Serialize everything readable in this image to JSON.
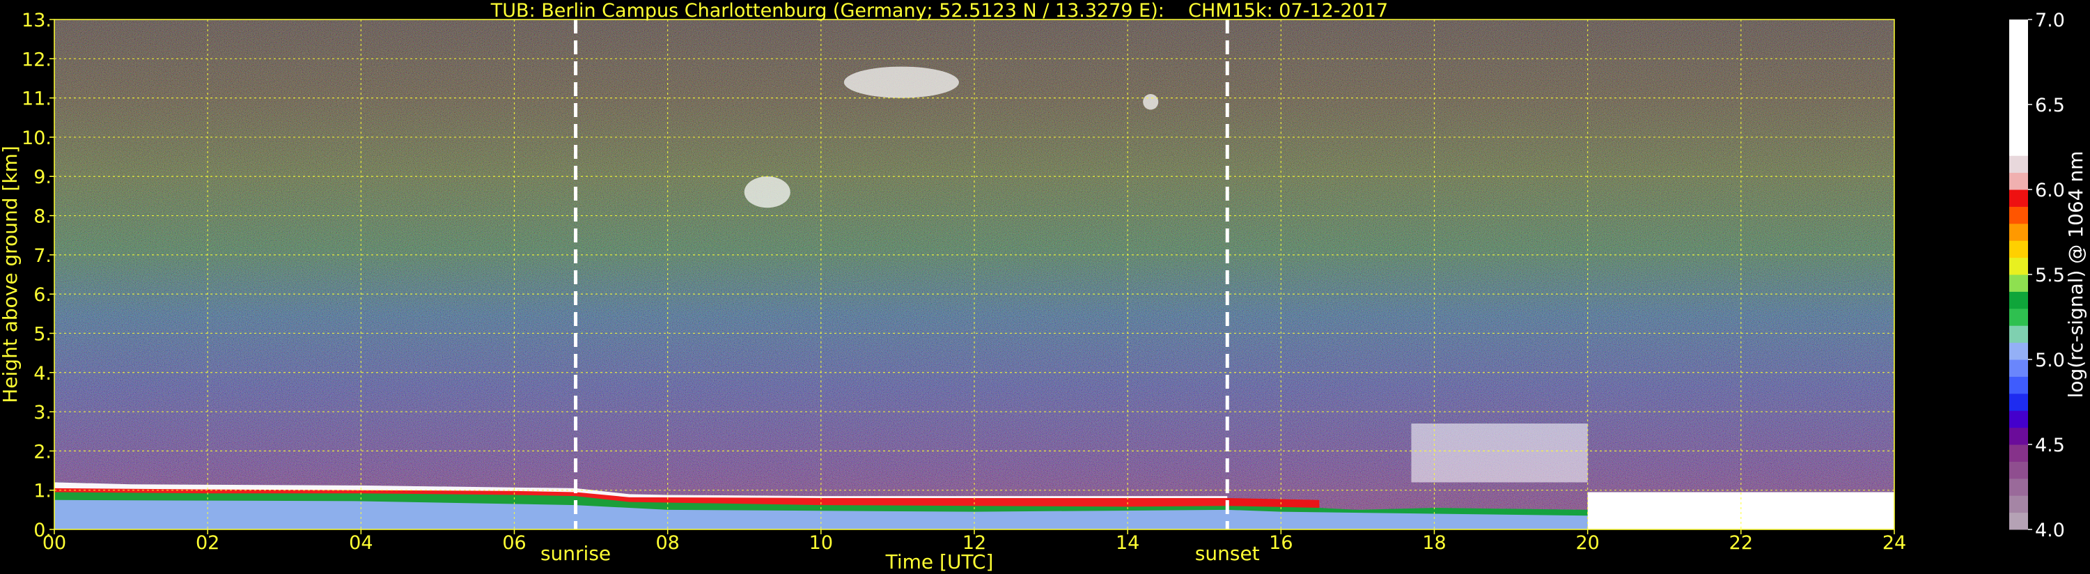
{
  "chart_data": {
    "type": "heatmap",
    "title": "TUB: Berlin Campus Charlottenburg (Germany; 52.5123 N / 13.3279 E):    CHM15k: 07-12-2017",
    "xlabel": "Time [UTC]",
    "ylabel": "Height above ground [km]",
    "xlim": [
      0,
      24
    ],
    "ylim": [
      0,
      13
    ],
    "x_ticks": [
      0,
      2,
      4,
      6,
      8,
      10,
      12,
      14,
      16,
      18,
      20,
      22,
      24
    ],
    "x_tick_labels": [
      "00",
      "02",
      "04",
      "06",
      "08",
      "10",
      "12",
      "14",
      "16",
      "18",
      "20",
      "22",
      "24"
    ],
    "y_ticks": [
      0,
      1,
      2,
      3,
      4,
      5,
      6,
      7,
      8,
      9,
      10,
      11,
      12,
      13
    ],
    "y_tick_labels": [
      "0.",
      "1.",
      "2.",
      "3.",
      "4.",
      "5.",
      "6.",
      "7.",
      "8.",
      "9.",
      "10.",
      "11.",
      "12.",
      "13."
    ],
    "grid": true,
    "grid_color": "#ffff33",
    "text_color": "#ffff33",
    "background": "#000000",
    "markers": [
      {
        "name": "sunrise",
        "time": 6.8
      },
      {
        "name": "sunset",
        "time": 15.3
      }
    ],
    "colorbar": {
      "label": "log(rc-signal) @ 1064 nm",
      "range": [
        4.0,
        7.0
      ],
      "ticks": [
        4.0,
        4.5,
        5.0,
        5.5,
        6.0,
        6.5,
        7.0
      ],
      "tick_labels": [
        "4.0",
        "4.5",
        "5.0",
        "5.5",
        "6.0",
        "6.5",
        "7.0"
      ],
      "colors": [
        {
          "from": 4.0,
          "to": 4.1,
          "color": "#b5a2b5"
        },
        {
          "from": 4.1,
          "to": 4.2,
          "color": "#a585a5"
        },
        {
          "from": 4.2,
          "to": 4.3,
          "color": "#9a6a9a"
        },
        {
          "from": 4.3,
          "to": 4.4,
          "color": "#8f4e8f"
        },
        {
          "from": 4.4,
          "to": 4.5,
          "color": "#86328a"
        },
        {
          "from": 4.5,
          "to": 4.6,
          "color": "#6b0c9a"
        },
        {
          "from": 4.6,
          "to": 4.7,
          "color": "#4400cc"
        },
        {
          "from": 4.7,
          "to": 4.8,
          "color": "#1e2cf0"
        },
        {
          "from": 4.8,
          "to": 4.9,
          "color": "#3f5cfd"
        },
        {
          "from": 4.9,
          "to": 5.0,
          "color": "#6a86fc"
        },
        {
          "from": 5.0,
          "to": 5.1,
          "color": "#94b0f6"
        },
        {
          "from": 5.1,
          "to": 5.2,
          "color": "#7fd0b0"
        },
        {
          "from": 5.2,
          "to": 5.3,
          "color": "#2fc050"
        },
        {
          "from": 5.3,
          "to": 5.4,
          "color": "#0fa53a"
        },
        {
          "from": 5.4,
          "to": 5.5,
          "color": "#8ee050"
        },
        {
          "from": 5.5,
          "to": 5.6,
          "color": "#e8f020"
        },
        {
          "from": 5.6,
          "to": 5.7,
          "color": "#ffd000"
        },
        {
          "from": 5.7,
          "to": 5.8,
          "color": "#ff9900"
        },
        {
          "from": 5.8,
          "to": 5.9,
          "color": "#ff5500"
        },
        {
          "from": 5.9,
          "to": 6.0,
          "color": "#ee1111"
        },
        {
          "from": 6.0,
          "to": 6.1,
          "color": "#f0b0b0"
        },
        {
          "from": 6.1,
          "to": 6.2,
          "color": "#e8d8dc"
        },
        {
          "from": 6.2,
          "to": 7.0,
          "color": "#ffffff"
        }
      ]
    },
    "layers": [
      {
        "name": "aerosol-bl-core",
        "color": "#94b0f6",
        "top": [
          [
            0,
            0.75
          ],
          [
            4,
            0.72
          ],
          [
            6.8,
            0.62
          ],
          [
            8,
            0.5
          ],
          [
            12,
            0.45
          ],
          [
            15.3,
            0.5
          ],
          [
            16,
            0.45
          ],
          [
            18,
            0.4
          ],
          [
            20,
            0.35
          ]
        ]
      },
      {
        "name": "aerosol-bl-green",
        "color": "#0fa53a",
        "top": [
          [
            0,
            0.95
          ],
          [
            2,
            0.92
          ],
          [
            4,
            0.92
          ],
          [
            6,
            0.88
          ],
          [
            6.8,
            0.85
          ],
          [
            7.5,
            0.7
          ],
          [
            10,
            0.62
          ],
          [
            12,
            0.6
          ],
          [
            14,
            0.58
          ],
          [
            15.3,
            0.6
          ],
          [
            16.5,
            0.55
          ],
          [
            17,
            0.5
          ],
          [
            18,
            0.55
          ],
          [
            20,
            0.5
          ]
        ]
      },
      {
        "name": "aerosol-bl-edge",
        "color": "#ee1111",
        "top": [
          [
            0,
            1.05
          ],
          [
            2,
            1.02
          ],
          [
            4,
            1.0
          ],
          [
            6,
            0.98
          ],
          [
            6.8,
            0.95
          ],
          [
            7.5,
            0.82
          ],
          [
            10,
            0.8
          ],
          [
            12,
            0.8
          ],
          [
            15.3,
            0.8
          ],
          [
            16.5,
            0.75
          ]
        ]
      },
      {
        "name": "bl-top-white",
        "color": "#ffffff",
        "top": [
          [
            0,
            1.2
          ],
          [
            1,
            1.15
          ],
          [
            4,
            1.12
          ],
          [
            6.8,
            1.05
          ],
          [
            7.5,
            0.9
          ],
          [
            8,
            0.88
          ],
          [
            10,
            0.85
          ],
          [
            12,
            0.85
          ],
          [
            15.3,
            0.85
          ]
        ]
      }
    ],
    "clouds": [
      {
        "name": "cirrus",
        "time": [
          9.0,
          9.6
        ],
        "height": [
          8.2,
          9.0
        ]
      },
      {
        "name": "cirrus",
        "time": [
          10.3,
          11.8
        ],
        "height": [
          11.0,
          11.8
        ]
      },
      {
        "name": "cirrus",
        "time": [
          14.2,
          14.4
        ],
        "height": [
          10.7,
          11.1
        ]
      },
      {
        "name": "low-cloud",
        "time": [
          17.7,
          20.0
        ],
        "height": [
          1.2,
          2.7
        ]
      },
      {
        "name": "fog-low-cloud",
        "time": [
          20.0,
          24.0
        ],
        "height": [
          0.0,
          0.95
        ]
      }
    ]
  }
}
